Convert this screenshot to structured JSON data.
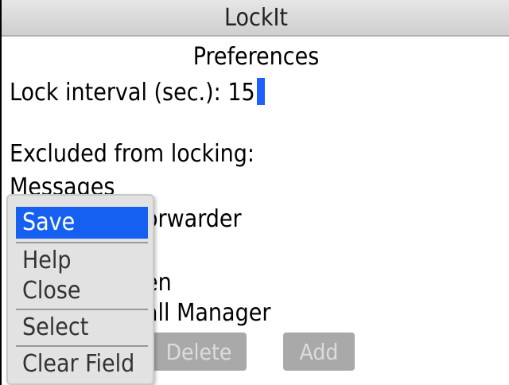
{
  "app": {
    "title": "LockIt"
  },
  "screen": {
    "heading": "Preferences"
  },
  "lock_interval": {
    "label": "Lock interval (sec.):",
    "value": "15"
  },
  "excluded": {
    "label": "Excluded from locking:",
    "items_visible": [
      "Messages",
      "orwarder",
      "en",
      "all Manager"
    ]
  },
  "buttons": {
    "delete": "Delete",
    "add": "Add"
  },
  "menu": {
    "items": [
      {
        "label": "Save",
        "selected": true
      },
      {
        "label": "Help",
        "selected": false
      },
      {
        "label": "Close",
        "selected": false
      },
      {
        "label": "Select",
        "selected": false
      },
      {
        "label": "Clear Field",
        "selected": false
      }
    ]
  },
  "colors": {
    "selection": "#1560f0",
    "cursor": "#1f5fff",
    "disabled_button": "#a9a9a9"
  }
}
